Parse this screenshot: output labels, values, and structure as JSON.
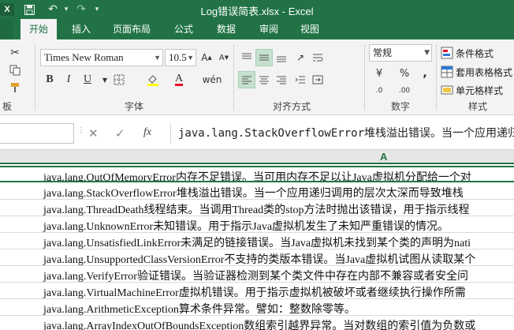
{
  "window": {
    "title": "Log错误简表.xlsx - Excel"
  },
  "tabs": [
    {
      "label": "开始",
      "active": true
    },
    {
      "label": "插入"
    },
    {
      "label": "页面布局"
    },
    {
      "label": "公式"
    },
    {
      "label": "数据"
    },
    {
      "label": "审阅"
    },
    {
      "label": "视图"
    }
  ],
  "ribbon": {
    "font_name": "Times New Roman",
    "font_size": "10.5",
    "number_format": "常规",
    "groups": {
      "clipboard": "板",
      "font": "字体",
      "alignment": "对齐方式",
      "number": "数字",
      "styles": "样式"
    },
    "styles_buttons": [
      "条件格式",
      "套用表格格式",
      "单元格样式"
    ],
    "icons": [
      "cut-icon",
      "copy-icon",
      "format-painter-icon",
      "bold-icon",
      "italic-icon",
      "underline-icon",
      "border-icon",
      "fill-color-icon",
      "font-color-icon",
      "wen-icon",
      "align-top-icon",
      "align-middle-icon",
      "align-bottom-icon",
      "wrap-icon",
      "align-left-icon",
      "align-center-icon",
      "align-right-icon",
      "merge-icon",
      "currency-icon",
      "percent-icon",
      "comma-icon"
    ]
  },
  "formula_bar": {
    "content": "java.lang.StackOverflowError堆栈溢出错误。当一个应用递归"
  },
  "sheet": {
    "column_header": "A",
    "rows": [
      "java.lang.OutOfMemoryError内存不足错误。当可用内存不足以让Java虚拟机分配给一个对",
      "java.lang.StackOverflowError堆栈溢出错误。当一个应用递归调用的层次太深而导致堆栈",
      "java.lang.ThreadDeath线程结束。当调用Thread类的stop方法时抛出该错误，用于指示线程",
      "java.lang.UnknownError未知错误。用于指示Java虚拟机发生了未知严重错误的情况。",
      "java.lang.UnsatisfiedLinkError未满足的链接错误。当Java虚拟机未找到某个类的声明为nati",
      "java.lang.UnsupportedClassVersionError不支持的类版本错误。当Java虚拟机试图从读取某个",
      "java.lang.VerifyError验证错误。当验证器检测到某个类文件中存在内部不兼容或者安全问",
      "java.lang.VirtualMachineError虚拟机错误。用于指示虚拟机被破坏或者继续执行操作所需",
      "java.lang.ArithmeticException算术条件异常。譬如：整数除零等。",
      "java.lang.ArrayIndexOutOfBoundsException数组索引越界异常。当对数组的索引值为负数或"
    ]
  }
}
